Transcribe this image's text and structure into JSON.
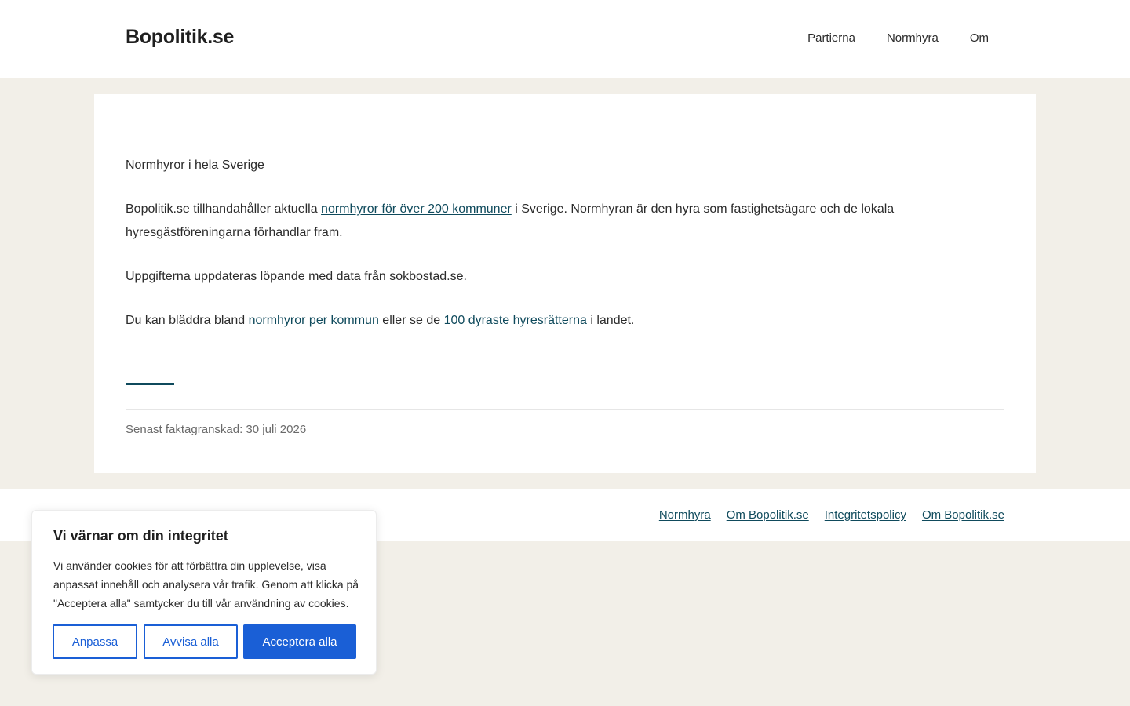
{
  "header": {
    "logo": "Bopolitik.se",
    "nav": [
      "Partierna",
      "Normhyra",
      "Om"
    ]
  },
  "main": {
    "heading": "Normhyror i hela Sverige",
    "p1_before": "Bopolitik.se tillhandahåller aktuella ",
    "p1_link": "normhyror för över 200 kommuner",
    "p1_after": " i Sverige. Normhyran är den hyra som fastighetsägare och de lokala hyresgästföreningarna förhandlar fram.",
    "p2": "Uppgifterna uppdateras löpande med data från sokbostad.se.",
    "p3_before": "Du kan bläddra bland ",
    "p3_link1": "normhyror per kommun",
    "p3_middle": " eller se de ",
    "p3_link2": "100 dyraste hyresrätterna",
    "p3_after": " i landet.",
    "factcheck": "Senast faktagranskad: 30 juli 2026"
  },
  "footer": {
    "links": [
      "Normhyra",
      "Om Bopolitik.se",
      "Integritetspolicy",
      "Om Bopolitik.se"
    ]
  },
  "cookie": {
    "title": "Vi värnar om din integritet",
    "text": "Vi använder cookies för att förbättra din upplevelse, visa anpassat innehåll och analysera vår trafik. Genom att klicka på \"Acceptera alla\" samtycker du till vår användning av cookies.",
    "customize_label": "Anpassa",
    "reject_label": "Avvisa alla",
    "accept_label": "Acceptera alla"
  },
  "colors": {
    "accent": "#0f4a5c",
    "button": "#1a5fd6",
    "page_bg": "#f2efe8"
  }
}
